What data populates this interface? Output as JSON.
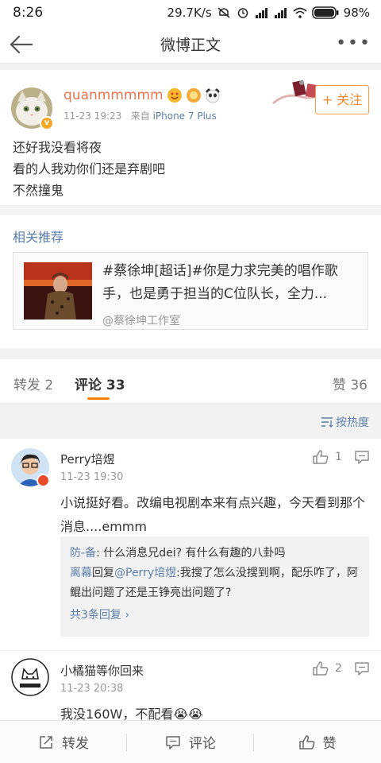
{
  "status_bar": {
    "time": "8:26",
    "speed": "29.7K/s",
    "battery": "98%"
  },
  "nav": {
    "title": "微博正文",
    "back_icon": "arrow-left-icon",
    "more_icon": "more-icon"
  },
  "post": {
    "username": "quanmmmmm",
    "time": "11-23 19:23",
    "source_prefix": "来自",
    "device": "iPhone 7 Plus",
    "follow_label": "+ 关注",
    "lines": [
      "还好我没看将夜",
      "看的人我劝你们还是弃剧吧",
      "不然撞鬼"
    ]
  },
  "recommend": {
    "title": "相关推荐",
    "card_text": "#蔡徐坤[超话]#你是力求完美的唱作歌手，也是勇于担当的C位队长，全力...",
    "source": "@蔡徐坤工作室"
  },
  "tabs": {
    "repost": "转发 2",
    "comment": "评论 33",
    "like": "赞 36"
  },
  "sort_label": "按热度",
  "comments": [
    {
      "name": "Perry培煜",
      "time": "11-23 19:30",
      "likes": "1",
      "text": "小说挺好看。改编电视剧本来有点兴趣，今天看到那个消息....emmm",
      "replies": [
        {
          "name": "防-备",
          "text": ": 什么消息兄dei? 有什么有趣的八卦吗"
        },
        {
          "name": "离幕",
          "mid": "回复",
          "mention": "@Perry培煜",
          "text": ":我搜了怎么没搜到啊，配乐咋了，阿鲲出问题了还是王铮亮出问题了?"
        }
      ],
      "more": "共3条回复 ›"
    },
    {
      "name": "小橘猫等你回来",
      "time": "11-23 20:38",
      "likes": "2",
      "text": "我没160W，不配看😭😭"
    }
  ],
  "bottom_bar": {
    "repost": "转发",
    "comment": "评论",
    "like": "赞"
  },
  "colors": {
    "accent_orange": "#ff8200",
    "link_blue": "#5b7fa8",
    "username_orange": "#eb7350"
  }
}
